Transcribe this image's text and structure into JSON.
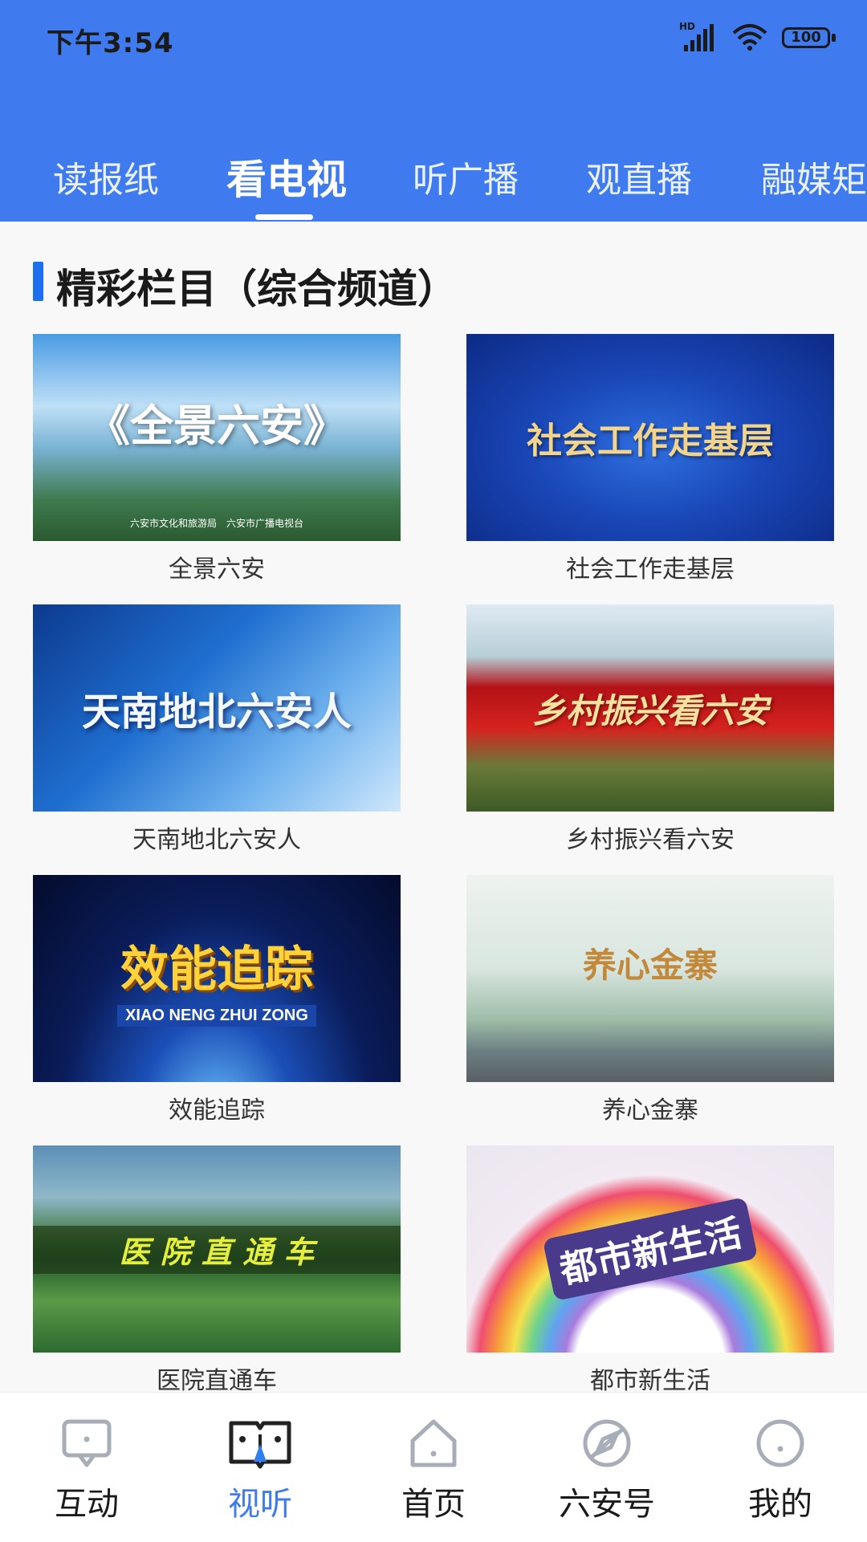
{
  "status_bar": {
    "time": "下午3:54",
    "network": "HD",
    "battery": "100"
  },
  "tabs": [
    {
      "label": "读报纸",
      "active": false
    },
    {
      "label": "看电视",
      "active": true
    },
    {
      "label": "听广播",
      "active": false
    },
    {
      "label": "观直播",
      "active": false
    },
    {
      "label": "融媒矩",
      "active": false
    }
  ],
  "section": {
    "title": "精彩栏目（综合频道）"
  },
  "programs": [
    {
      "name": "全景六安",
      "thumb_title": "《全景六安》",
      "thumb_footer": "六安市文化和旅游局　六安市广播电视台"
    },
    {
      "name": "社会工作走基层",
      "thumb_title": "社会工作走基层"
    },
    {
      "name": "天南地北六安人",
      "thumb_title": "天南地北六安人"
    },
    {
      "name": "乡村振兴看六安",
      "thumb_title": "乡村振兴看六安"
    },
    {
      "name": "效能追踪",
      "thumb_title": "效能追踪",
      "thumb_subtitle": "XIAO NENG ZHUI ZONG"
    },
    {
      "name": "养心金寨",
      "thumb_title": "养心金寨"
    },
    {
      "name": "医院直通车",
      "thumb_title": "医 院 直 通 车"
    },
    {
      "name": "都市新生活",
      "thumb_title": "都市新生活"
    }
  ],
  "bottom_nav": [
    {
      "label": "互动",
      "icon": "chat-bubble-icon",
      "active": false
    },
    {
      "label": "视听",
      "icon": "open-book-icon",
      "active": true
    },
    {
      "label": "首页",
      "icon": "home-icon",
      "active": false
    },
    {
      "label": "六安号",
      "icon": "compass-icon",
      "active": false
    },
    {
      "label": "我的",
      "icon": "profile-icon",
      "active": false
    }
  ],
  "colors": {
    "brand": "#3f7bee",
    "section_accent": "#1e6ff0"
  }
}
